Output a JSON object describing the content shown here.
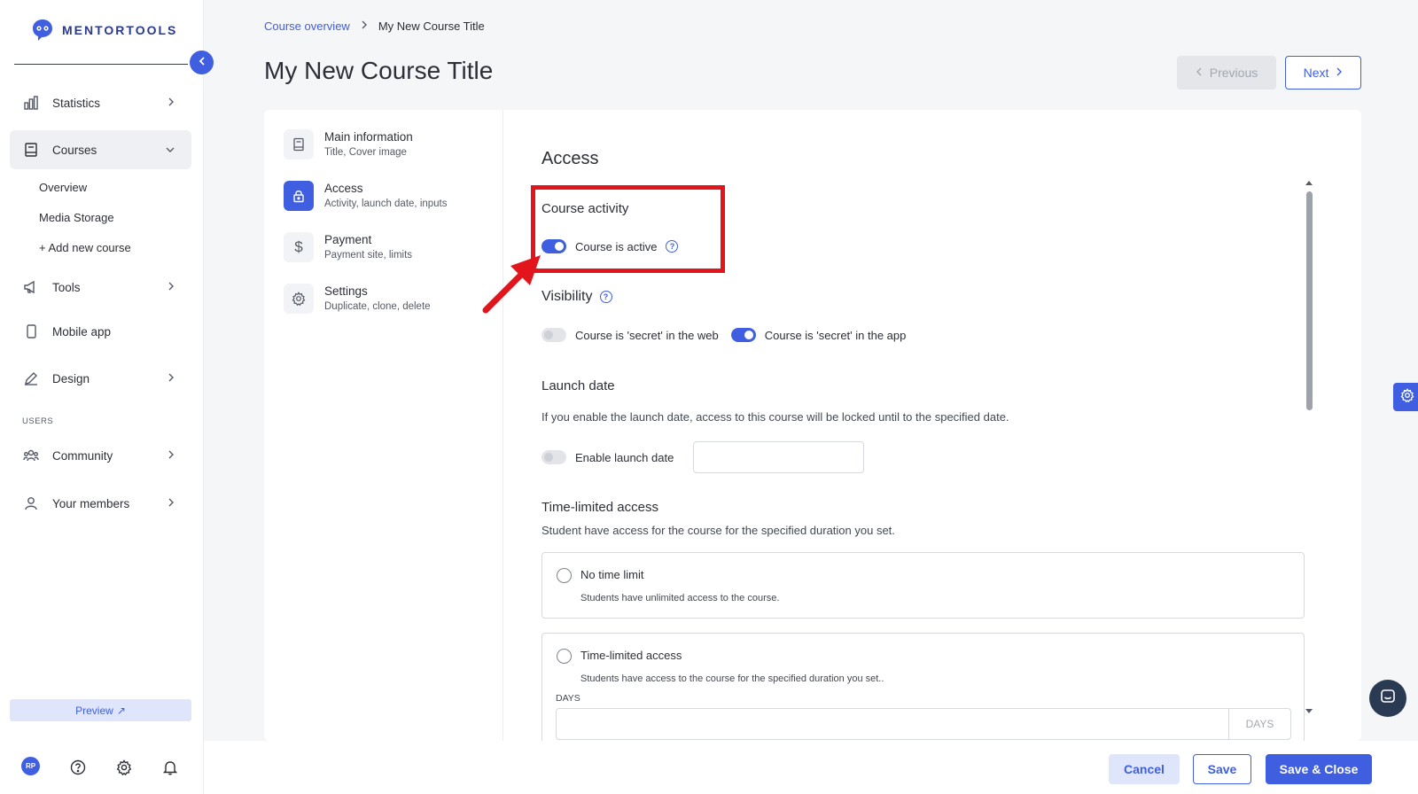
{
  "app": {
    "brand": "MENTORTOOLS",
    "colors": {
      "accent": "#3f5fe0",
      "highlight": "#e2151d"
    }
  },
  "sidebar": {
    "items": [
      {
        "label": "Statistics",
        "icon": "bar-chart-icon"
      },
      {
        "label": "Courses",
        "icon": "book-icon"
      },
      {
        "label": "Tools",
        "icon": "megaphone-icon"
      },
      {
        "label": "Mobile app",
        "icon": "mobile-icon"
      },
      {
        "label": "Design",
        "icon": "pencil-icon"
      },
      {
        "label": "Community",
        "icon": "people-icon"
      },
      {
        "label": "Your members",
        "icon": "user-icon"
      }
    ],
    "course_subitems": [
      "Overview",
      "Media Storage",
      "+ Add new course"
    ],
    "section_users": "USERS",
    "preview_label": "Preview",
    "avatar_initials": "RP"
  },
  "header": {
    "breadcrumb": {
      "link": "Course overview",
      "current": "My New Course Title"
    },
    "title": "My New Course Title",
    "prev_label": "Previous",
    "next_label": "Next"
  },
  "steps": [
    {
      "title": "Main information",
      "sub": "Title, Cover image",
      "icon": "document-icon"
    },
    {
      "title": "Access",
      "sub": "Activity, launch date, inputs",
      "icon": "lock-icon"
    },
    {
      "title": "Payment",
      "sub": "Payment site, limits",
      "icon": "dollar-icon"
    },
    {
      "title": "Settings",
      "sub": "Duplicate, clone, delete",
      "icon": "gear-icon"
    }
  ],
  "access": {
    "heading": "Access",
    "course_activity": {
      "heading": "Course activity",
      "toggle_label": "Course is active",
      "on": true
    },
    "visibility": {
      "heading": "Visibility",
      "web_label": "Course is 'secret' in the web",
      "web_on": false,
      "app_label": "Course is 'secret' in the app",
      "app_on": true
    },
    "launch_date": {
      "heading": "Launch date",
      "description": "If you enable the launch date, access to this course will be locked until to the specified date.",
      "toggle_label": "Enable launch date",
      "value": ""
    },
    "time_limited": {
      "heading": "Time-limited access",
      "description": "Student have access for the course for the specified duration you set.",
      "options": [
        {
          "title": "No time limit",
          "sub": "Students have unlimited access to the course."
        },
        {
          "title": "Time-limited access",
          "sub": "Students have access to the course for the specified duration you set.."
        }
      ],
      "days_label": "DAYS",
      "days_suffix": "DAYS"
    }
  },
  "footer": {
    "cancel": "Cancel",
    "save": "Save",
    "save_close": "Save & Close"
  }
}
